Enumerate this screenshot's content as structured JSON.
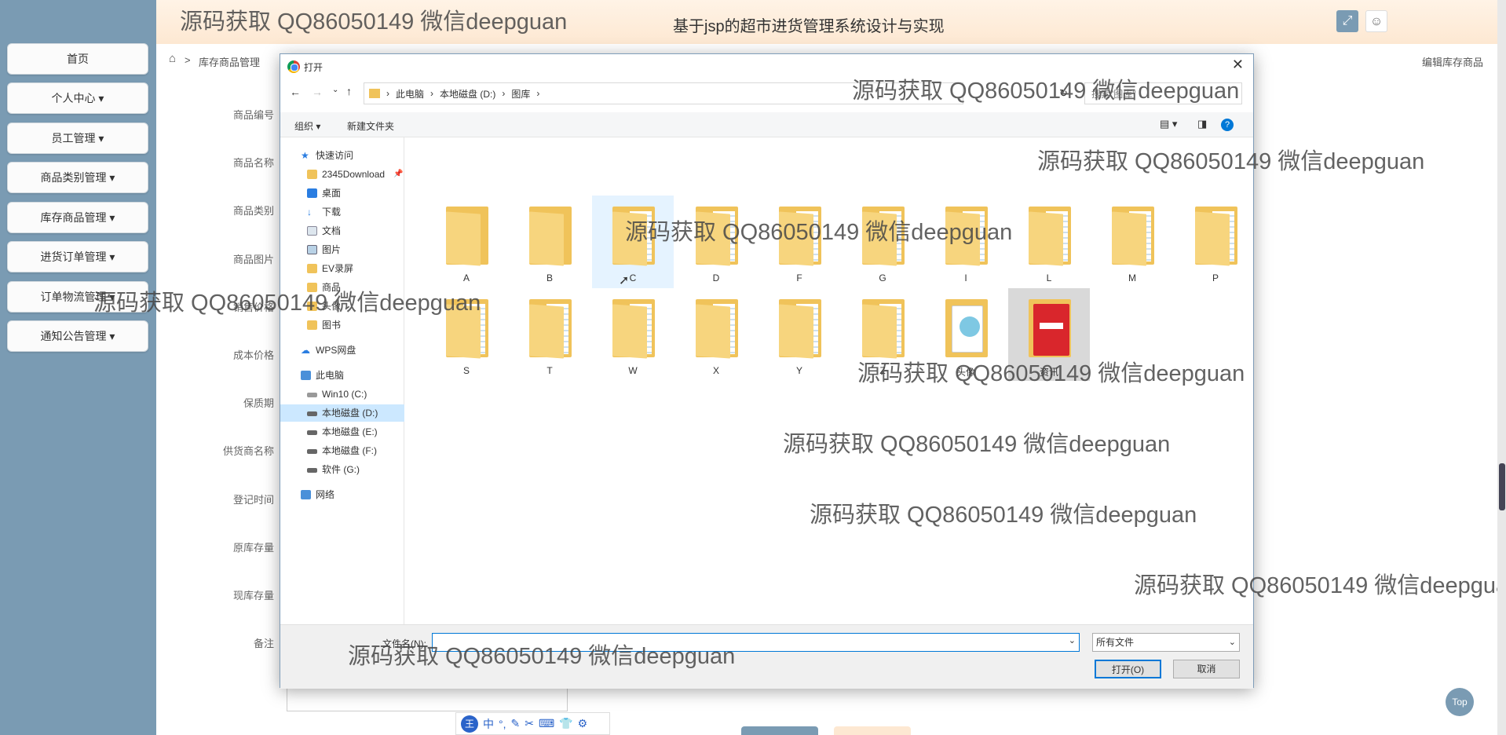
{
  "app": {
    "title": "基于jsp的超市进货管理系统设计与实现",
    "breadcrumb_section": "库存商品管理",
    "breadcrumb_current": "编辑库存商品"
  },
  "sidebar": {
    "items": [
      {
        "label": "首页"
      },
      {
        "label": "个人中心 ▾"
      },
      {
        "label": "员工管理 ▾"
      },
      {
        "label": "商品类别管理 ▾"
      },
      {
        "label": "库存商品管理 ▾"
      },
      {
        "label": "进货订单管理 ▾"
      },
      {
        "label": "订单物流管理 ▾"
      },
      {
        "label": "通知公告管理 ▾"
      }
    ]
  },
  "form": {
    "labels": [
      "商品编号",
      "商品名称",
      "商品类别",
      "商品图片",
      "销售价格",
      "成本价格",
      "保质期",
      "供货商名称",
      "登记时间",
      "原库存量",
      "现库存量",
      "备注"
    ]
  },
  "dialog": {
    "title": "打开",
    "address": [
      "此电脑",
      "本地磁盘 (D:)",
      "图库"
    ],
    "search_placeholder": "搜索\"图库\"",
    "toolbar": {
      "organize": "组织 ▾",
      "new_folder": "新建文件夹"
    },
    "nav": {
      "quick_access": "快速访问",
      "quick_items": [
        "2345Download",
        "桌面",
        "下载",
        "文档",
        "图片",
        "EV录屏",
        "商品",
        "头像",
        "图书"
      ],
      "wps": "WPS网盘",
      "this_pc": "此电脑",
      "drives": [
        "Win10 (C:)",
        "本地磁盘 (D:)",
        "本地磁盘 (E:)",
        "本地磁盘 (F:)",
        "软件 (G:)"
      ],
      "network": "网络"
    },
    "files": {
      "row1": [
        "A",
        "B",
        "C",
        "D",
        "F",
        "G",
        "I",
        "L",
        "M",
        "P"
      ],
      "row2": [
        "S",
        "T",
        "W",
        "X",
        "Y",
        "Z",
        "头像",
        "资讯"
      ]
    },
    "filename_label": "文件名(N):",
    "filename_value": "",
    "filter": "所有文件",
    "open_button": "打开(O)",
    "cancel_button": "取消"
  },
  "ime": {
    "items": [
      "王",
      "中",
      "°,",
      "✎",
      "✂",
      "⌨",
      "👕",
      "⚙"
    ]
  },
  "top_button": "Top",
  "watermark": "源码获取 QQ86050149 微信deepguan",
  "colors": {
    "sidebar": "#7a9bb3",
    "header": "#fde8d2",
    "selected": "#cce8ff",
    "accent": "#0078d7"
  }
}
